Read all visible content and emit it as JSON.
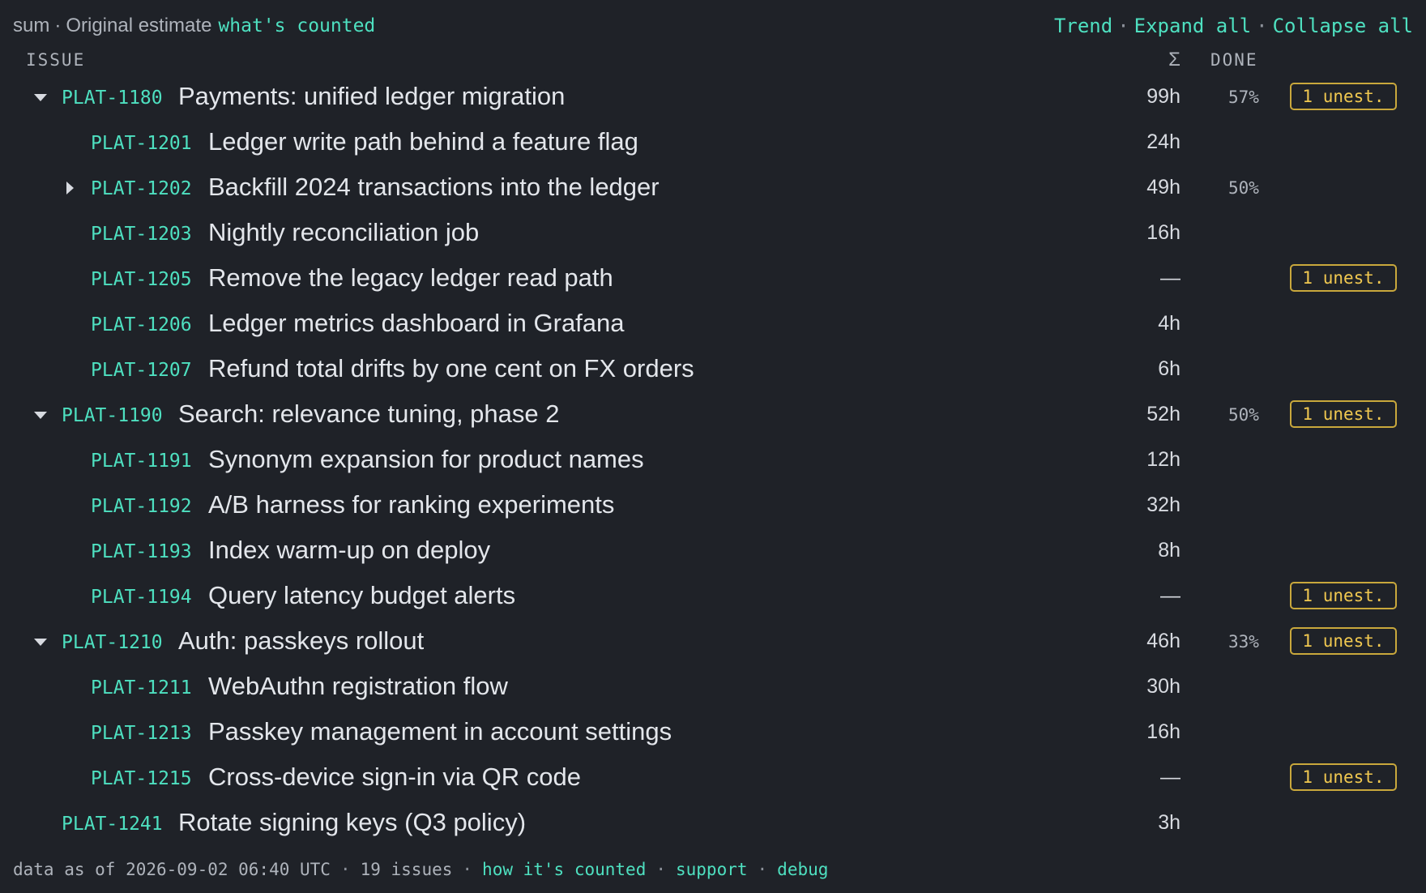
{
  "topbar": {
    "agg": "sum",
    "field": "Original estimate",
    "whats_counted": "what's counted",
    "trend": "Trend",
    "expand_all": "Expand all",
    "collapse_all": "Collapse all"
  },
  "header": {
    "issue": "ISSUE",
    "sum": "Σ",
    "done": "DONE"
  },
  "rows": [
    {
      "level": 0,
      "toggle": "expanded",
      "key": "PLAT-1180",
      "title": "Payments: unified ledger migration",
      "sum": "99h",
      "done": "57%",
      "badge": "1 unest."
    },
    {
      "level": 1,
      "toggle": "none",
      "key": "PLAT-1201",
      "title": "Ledger write path behind a feature flag",
      "sum": "24h",
      "done": "",
      "badge": ""
    },
    {
      "level": 1,
      "toggle": "collapsed",
      "key": "PLAT-1202",
      "title": "Backfill 2024 transactions into the ledger",
      "sum": "49h",
      "done": "50%",
      "badge": ""
    },
    {
      "level": 1,
      "toggle": "none",
      "key": "PLAT-1203",
      "title": "Nightly reconciliation job",
      "sum": "16h",
      "done": "",
      "badge": ""
    },
    {
      "level": 1,
      "toggle": "none",
      "key": "PLAT-1205",
      "title": "Remove the legacy ledger read path",
      "sum": "—",
      "done": "",
      "badge": "1 unest."
    },
    {
      "level": 1,
      "toggle": "none",
      "key": "PLAT-1206",
      "title": "Ledger metrics dashboard in Grafana",
      "sum": "4h",
      "done": "",
      "badge": ""
    },
    {
      "level": 1,
      "toggle": "none",
      "key": "PLAT-1207",
      "title": "Refund total drifts by one cent on FX orders",
      "sum": "6h",
      "done": "",
      "badge": ""
    },
    {
      "level": 0,
      "toggle": "expanded",
      "key": "PLAT-1190",
      "title": "Search: relevance tuning, phase 2",
      "sum": "52h",
      "done": "50%",
      "badge": "1 unest."
    },
    {
      "level": 1,
      "toggle": "none",
      "key": "PLAT-1191",
      "title": "Synonym expansion for product names",
      "sum": "12h",
      "done": "",
      "badge": ""
    },
    {
      "level": 1,
      "toggle": "none",
      "key": "PLAT-1192",
      "title": "A/B harness for ranking experiments",
      "sum": "32h",
      "done": "",
      "badge": ""
    },
    {
      "level": 1,
      "toggle": "none",
      "key": "PLAT-1193",
      "title": "Index warm-up on deploy",
      "sum": "8h",
      "done": "",
      "badge": ""
    },
    {
      "level": 1,
      "toggle": "none",
      "key": "PLAT-1194",
      "title": "Query latency budget alerts",
      "sum": "—",
      "done": "",
      "badge": "1 unest."
    },
    {
      "level": 0,
      "toggle": "expanded",
      "key": "PLAT-1210",
      "title": "Auth: passkeys rollout",
      "sum": "46h",
      "done": "33%",
      "badge": "1 unest."
    },
    {
      "level": 1,
      "toggle": "none",
      "key": "PLAT-1211",
      "title": "WebAuthn registration flow",
      "sum": "30h",
      "done": "",
      "badge": ""
    },
    {
      "level": 1,
      "toggle": "none",
      "key": "PLAT-1213",
      "title": "Passkey management in account settings",
      "sum": "16h",
      "done": "",
      "badge": ""
    },
    {
      "level": 1,
      "toggle": "none",
      "key": "PLAT-1215",
      "title": "Cross-device sign-in via QR code",
      "sum": "—",
      "done": "",
      "badge": "1 unest."
    },
    {
      "level": 0,
      "toggle": "none",
      "key": "PLAT-1241",
      "title": "Rotate signing keys (Q3 policy)",
      "sum": "3h",
      "done": "",
      "badge": ""
    }
  ],
  "footer": {
    "as_of": "data as of 2026-09-02 06:40 UTC",
    "count": "19 issues",
    "how_counted": "how it's counted",
    "support": "support",
    "debug": "debug"
  },
  "colors": {
    "background": "#1f2228",
    "accent": "#4ee0c0",
    "badge": "#f0c850"
  }
}
